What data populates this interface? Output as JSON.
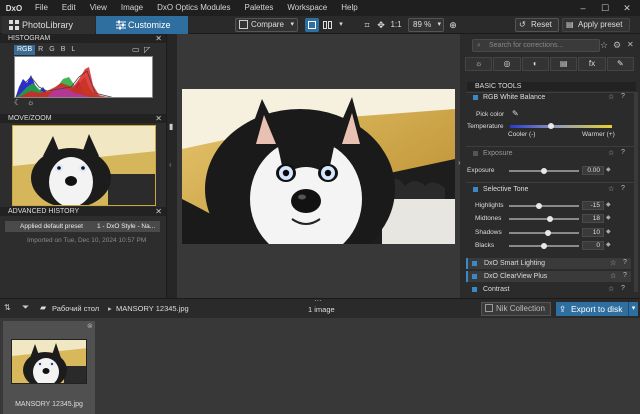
{
  "app": {
    "logo_text": "DxO",
    "menu": [
      "File",
      "Edit",
      "View",
      "Image",
      "DxO Optics Modules",
      "Palettes",
      "Workspace",
      "Help"
    ],
    "window_controls": [
      "–",
      "☐",
      "✕"
    ]
  },
  "toolbar": {
    "tab_library": "PhotoLibrary",
    "tab_customize": "Customize",
    "compare_label": "Compare",
    "zoom_one_to_one": "1:1",
    "zoom_value": "89 %",
    "reset_label": "Reset",
    "apply_preset_label": "Apply preset"
  },
  "left": {
    "histogram_title": "HISTOGRAM",
    "histogram_channels": [
      "RGB",
      "R",
      "G",
      "B",
      "L"
    ],
    "histogram_active": "RGB",
    "move_zoom_title": "MOVE/ZOOM",
    "advanced_history_title": "ADVANCED HISTORY",
    "history": [
      {
        "name": "Applied default preset",
        "detail": "1 - DxO Style - Na..."
      },
      {
        "name": "Imported on Tue, Dec 10, 2024 10:57 PM",
        "detail": ""
      }
    ]
  },
  "right": {
    "search_placeholder": "Search for corrections...",
    "palette_tabs": [
      "☼",
      "◎",
      "◐",
      "▤",
      "fx",
      "✎"
    ],
    "basic_tools_title": "BASIC TOOLS",
    "white_balance": {
      "title": "RGB White Balance",
      "pick_color": "Pick color",
      "temperature": "Temperature",
      "cooler": "Cooler (-)",
      "warmer": "Warmer (+)"
    },
    "exposure": {
      "title": "Exposure",
      "label": "Exposure",
      "value": "0.00",
      "level": 0.5
    },
    "selective_tone": {
      "title": "Selective Tone",
      "rows": [
        {
          "label": "Highlights",
          "value": "-15",
          "level": 0.43
        },
        {
          "label": "Midtones",
          "value": "18",
          "level": 0.58
        },
        {
          "label": "Shadows",
          "value": "10",
          "level": 0.55
        },
        {
          "label": "Blacks",
          "value": "0",
          "level": 0.5
        }
      ]
    },
    "smart_lighting": "DxO Smart Lighting",
    "clearview": "DxO ClearView Plus",
    "contrast": "Contrast"
  },
  "bottom": {
    "folder_path": "Рабочий стол",
    "file_name": "MANSORY 12345.jpg",
    "image_count": "1 image",
    "nik_label": "Nik Collection",
    "export_label": "Export to disk",
    "thumb_label": "MANSORY 12345.jpg"
  },
  "colors": {
    "accent": "#2f6fa0",
    "bullet": "#3a88c8",
    "panel": "#2b2b2b"
  }
}
